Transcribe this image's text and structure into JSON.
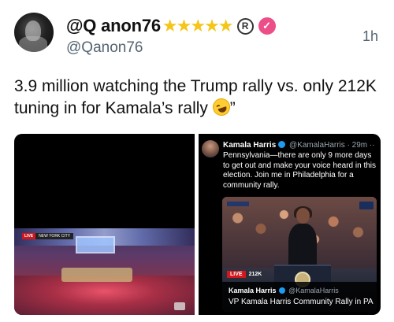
{
  "tweet": {
    "display_name": "@Q anon76",
    "stars": "★★★★★",
    "registered_mark": "R",
    "verified_badge": "✓",
    "username": "@Qanon76",
    "timestamp": "1h",
    "text_before_emoji": "3.9 million watching the Trump rally vs. only 212K tuning in for Kamala’s rally ",
    "emoji": "rolling-on-floor-laughing-emoji",
    "text_after_emoji": "”"
  },
  "media_left": {
    "live_label": "LIVE",
    "location_label": "NEW YORK CITY"
  },
  "media_right": {
    "embedded_tweet": {
      "name": "Kamala Harris",
      "handle_time": "@KamalaHarris · 29m",
      "more": "··",
      "body": "Pennsylvania—there are only 9 more days to get out and make your voice heard in this election. Join me in Philadelphia for a community rally."
    },
    "video": {
      "live_label": "LIVE",
      "viewer_count": "212K",
      "sign_text": "HARRIS WALZ",
      "footer_name": "Kamala Harris",
      "footer_handle": "@KamalaHarris",
      "footer_title": "VP Kamala Harris Community Rally in PA"
    }
  },
  "colors": {
    "stars": "#f5c518",
    "verified_pink": "#ec4e88",
    "secondary_text": "#536471",
    "live_red": "#d1171b",
    "twitter_blue": "#1d9bf0"
  }
}
